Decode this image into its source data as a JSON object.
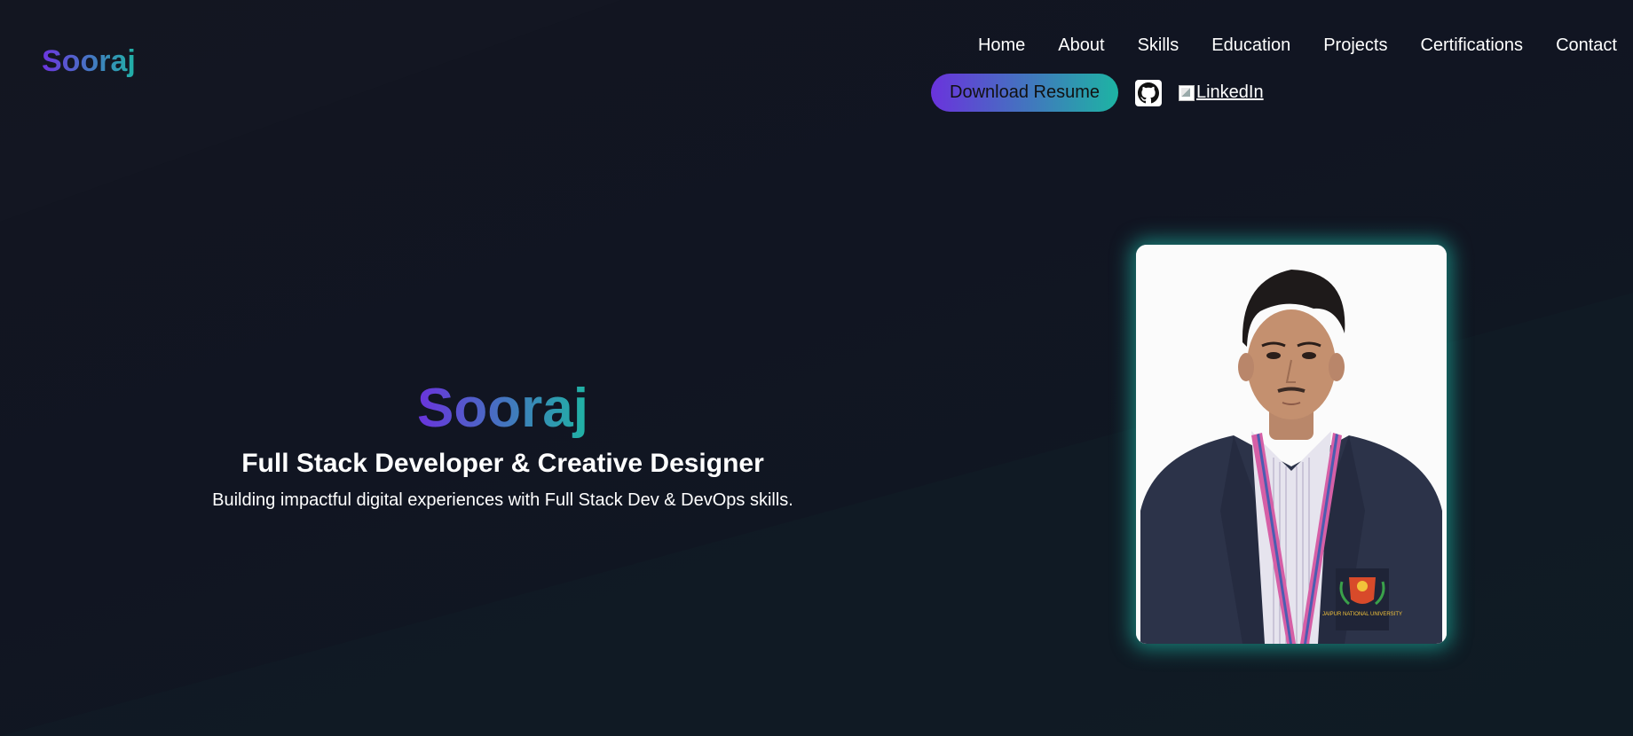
{
  "header": {
    "logo": "Sooraj",
    "nav": [
      "Home",
      "About",
      "Skills",
      "Education",
      "Projects",
      "Certifications",
      "Contact"
    ],
    "resume_label": "Download Resume",
    "github_icon": "github-icon",
    "linkedin_label": "LinkedIn"
  },
  "hero": {
    "name": "Sooraj",
    "role": "Full Stack Developer & Creative Designer",
    "tagline": "Building impactful digital experiences with Full Stack Dev & DevOps skills.",
    "badge_text": "JAIPUR NATIONAL UNIVERSITY"
  },
  "colors": {
    "accent_purple": "#6a33dc",
    "accent_teal": "#1fb4a4",
    "background": "#121520"
  }
}
